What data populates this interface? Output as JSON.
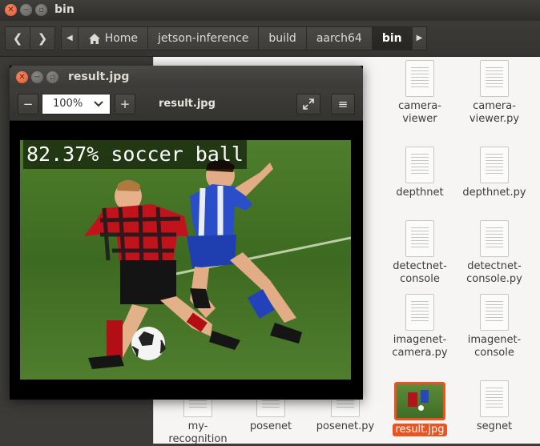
{
  "file_manager": {
    "title": "bin",
    "breadcrumbs": [
      "Home",
      "jetson-inference",
      "build",
      "aarch64",
      "bin"
    ],
    "active_crumb": "bin",
    "files_row1": [
      "camera-\nviewer",
      "camera-\nviewer.py"
    ],
    "files": [
      {
        "label": "camera-viewer"
      },
      {
        "label": "camera-viewer.py"
      },
      {
        "label": "depthnet"
      },
      {
        "label": "depthnet.py"
      },
      {
        "label": "detectnet-console"
      },
      {
        "label": "detectnet-console.py"
      },
      {
        "label": "imagenet-camera.py"
      },
      {
        "label": "imagenet-console"
      },
      {
        "label": "my-recognition"
      },
      {
        "label": "posenet"
      },
      {
        "label": "posenet.py"
      },
      {
        "label": "result.jpg"
      },
      {
        "label": "segnet"
      }
    ],
    "accent_color": "#e95420"
  },
  "viewer": {
    "title": "result.jpg",
    "zoom": "100%",
    "image_name": "result.jpg",
    "overlay": "82.37% soccer ball"
  }
}
